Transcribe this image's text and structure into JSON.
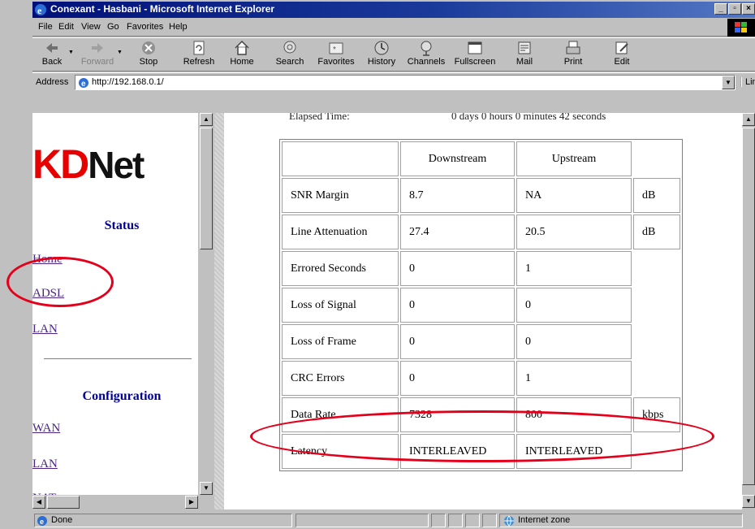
{
  "window": {
    "title": "Conexant - Hasbani - Microsoft Internet Explorer"
  },
  "menu": [
    "File",
    "Edit",
    "View",
    "Go",
    "Favorites",
    "Help"
  ],
  "toolbar": {
    "back": "Back",
    "forward": "Forward",
    "stop": "Stop",
    "refresh": "Refresh",
    "home": "Home",
    "search": "Search",
    "favorites": "Favorites",
    "history": "History",
    "channels": "Channels",
    "fullscreen": "Fullscreen",
    "mail": "Mail",
    "print": "Print",
    "edit": "Edit"
  },
  "address": {
    "label": "Address",
    "url": "http://192.168.0.1/",
    "links": "Links"
  },
  "sidebar": {
    "logo_kd": "KD",
    "logo_net": "Net",
    "status_title": "Status",
    "status_links": [
      "Home",
      "ADSL",
      "LAN"
    ],
    "config_title": "Configuration",
    "config_links": [
      "WAN",
      "LAN",
      "NAT"
    ]
  },
  "main": {
    "elapsed_label": "Elapsed Time:",
    "elapsed_value": "0 days 0 hours 0 minutes 42 seconds",
    "table": {
      "headers": [
        "",
        "Downstream",
        "Upstream",
        ""
      ],
      "rows": [
        [
          "SNR Margin",
          "8.7",
          "NA",
          "dB"
        ],
        [
          "Line Attenuation",
          "27.4",
          "20.5",
          "dB"
        ],
        [
          "Errored Seconds",
          "0",
          "1",
          ""
        ],
        [
          "Loss of Signal",
          "0",
          "0",
          ""
        ],
        [
          "Loss of Frame",
          "0",
          "0",
          ""
        ],
        [
          "CRC Errors",
          "0",
          "1",
          ""
        ],
        [
          "Data Rate",
          "7328",
          "800",
          "kbps"
        ],
        [
          "Latency",
          "INTERLEAVED",
          "INTERLEAVED",
          ""
        ]
      ]
    }
  },
  "statusbar": {
    "text": "Done",
    "zone": "Internet zone"
  },
  "colors": {
    "highlight_oval": "#e4001b",
    "link_visited": "#4b2485",
    "section_title": "#000099",
    "logo_red": "#e60000"
  }
}
